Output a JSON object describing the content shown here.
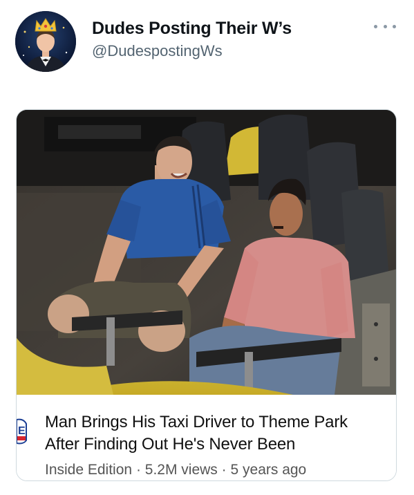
{
  "tweet": {
    "author": {
      "display_name": "Dudes Posting Their W’s",
      "handle": "@DudespostingWs",
      "avatar": "crowned-man-in-tuxedo-avatar"
    },
    "more_icon": "more-horizontal-icon",
    "media": {
      "image": "two-men-riding-roller-coaster-photo",
      "headline_line1": "Man Brings His Taxi Driver to Theme Park",
      "headline_line2": "After Finding Out He's Never Been",
      "source": "Inside Edition",
      "views": "5.2M views",
      "age": "5 years ago",
      "separator": "·",
      "source_logo_letter": "E"
    }
  },
  "colors": {
    "text": "#0f1419",
    "secondary": "#536471",
    "border": "#cfd9de",
    "seat_yellow": "#e8cc3a",
    "seat_dark": "#2a2d33"
  }
}
